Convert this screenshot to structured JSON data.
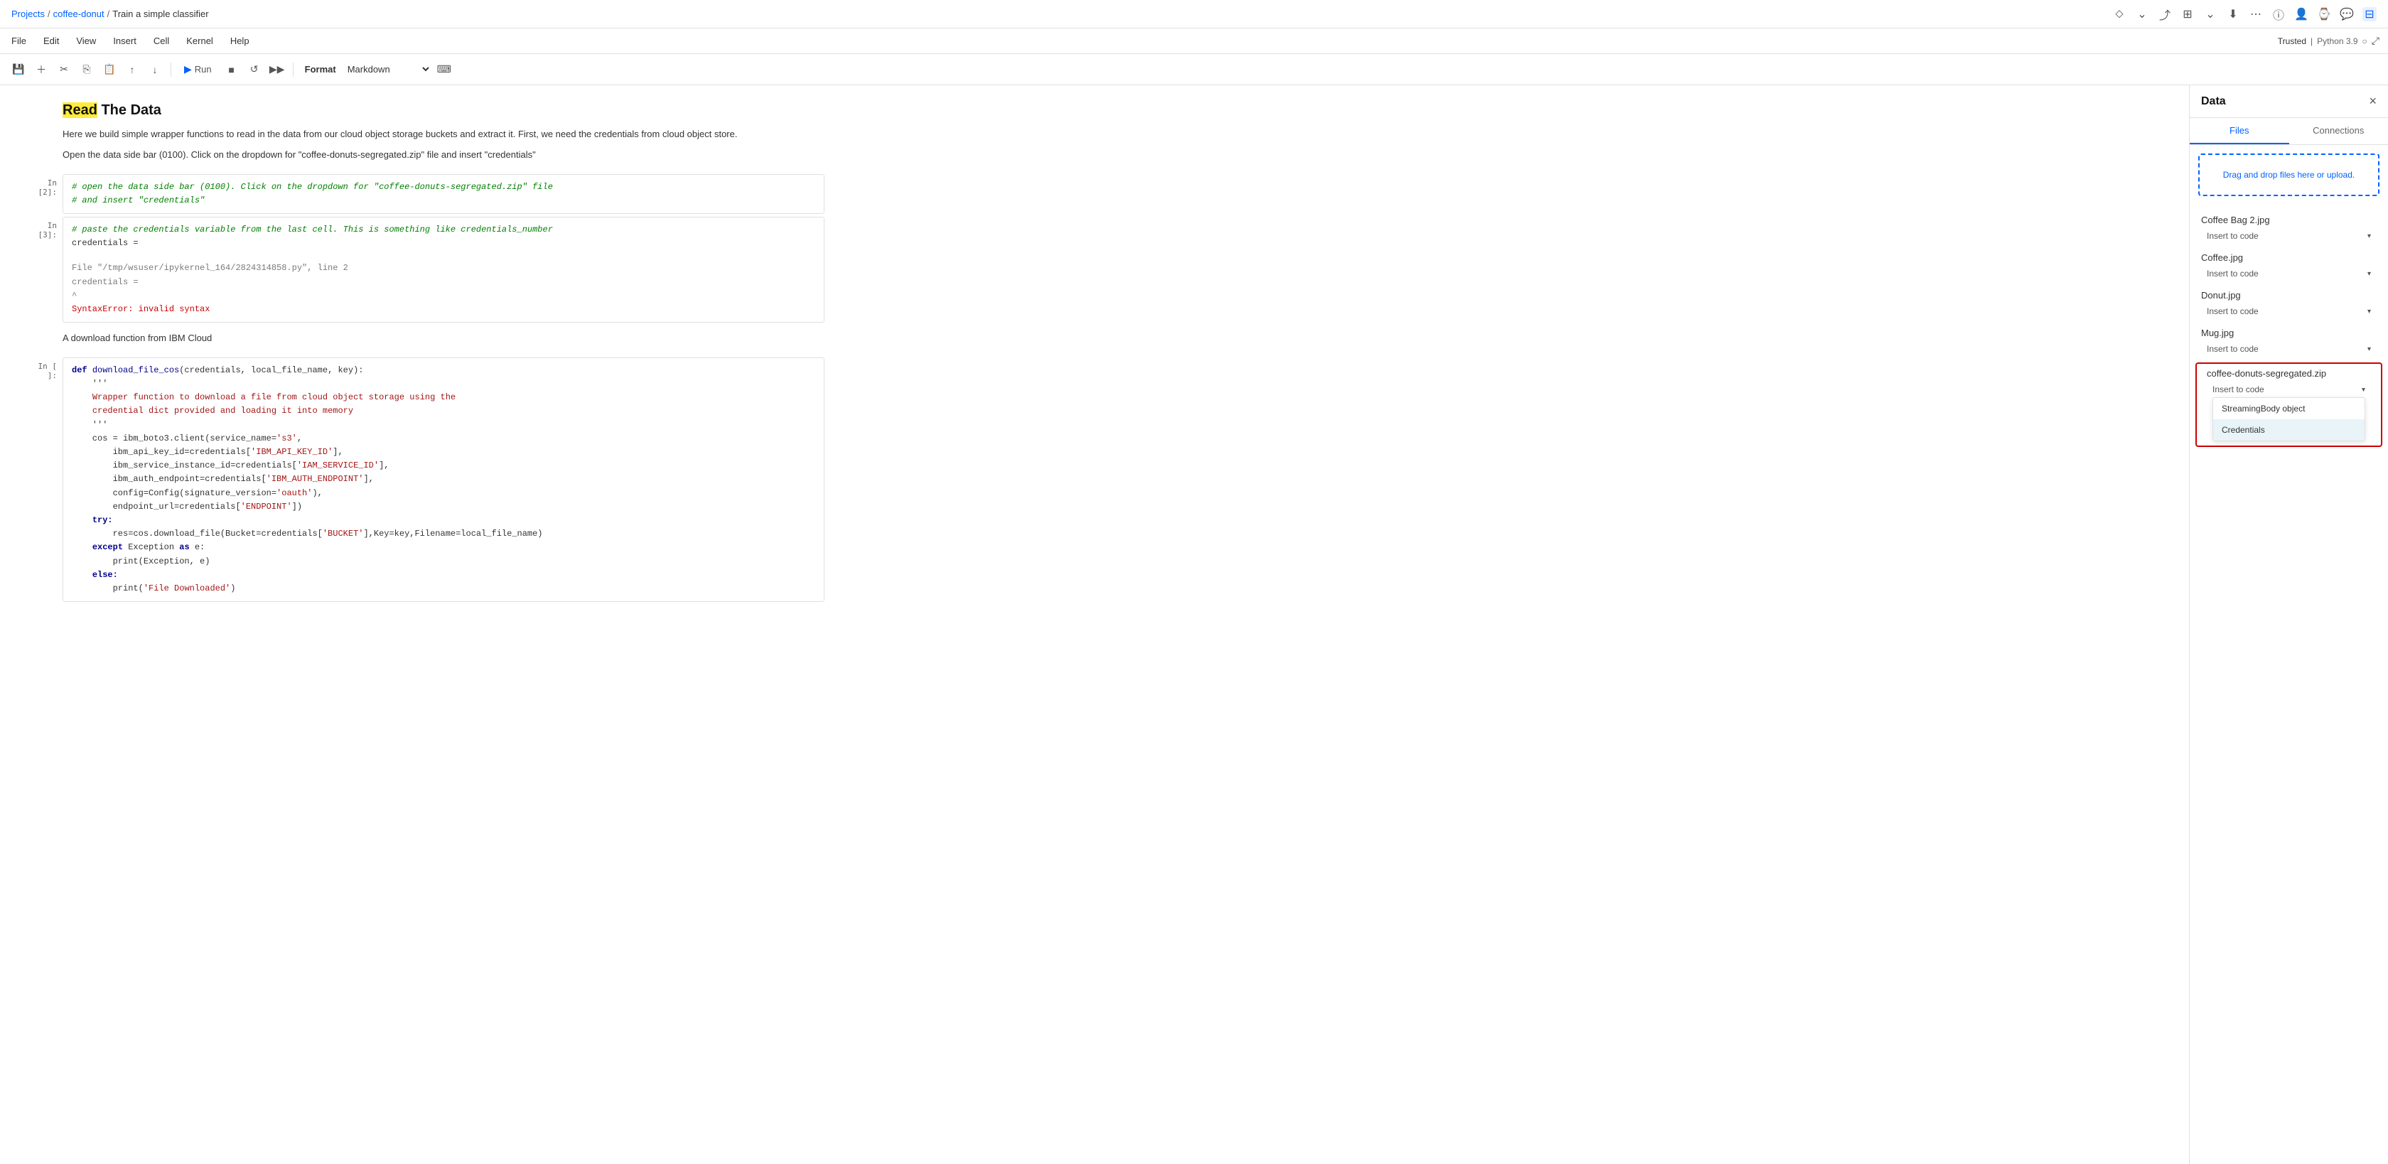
{
  "topnav": {
    "breadcrumb": [
      "Projects",
      "coffee-donut",
      "Train a simple classifier"
    ],
    "sep": "/"
  },
  "menubar": {
    "items": [
      "File",
      "Edit",
      "View",
      "Insert",
      "Cell",
      "Kernel",
      "Help"
    ],
    "trusted": "Trusted",
    "kernel": "Python 3.9"
  },
  "toolbar": {
    "format_label": "Format",
    "format_value": "Markdown",
    "run_label": "Run"
  },
  "notebook": {
    "title": "Read The Data",
    "title_highlight": "Read",
    "para1": "Here we build simple wrapper functions to read in the data from our cloud object storage buckets and extract it. First, we need the credentials from cloud object store.",
    "para2": "Open the data side bar (0100). Click on the dropdown for \"coffee-donuts-segregated.zip\" file and insert \"credentials\"",
    "cell2_label": "In [2]:",
    "cell2_code": "# open the data side bar (0100). Click on the dropdown for \"coffee-donuts-segregated.zip\" file\n# and insert \"credentials\"",
    "cell3_label": "In [3]:",
    "cell3_code": "# paste the credentials variable from the last cell. This is something like credentials_number\ncredentials =",
    "cell3_output_trace1": "File \"/tmp/wsuser/ipykernel_164/2824314858.py\", line 2",
    "cell3_output_trace2": "    credentials =",
    "cell3_output_trace3": "                 ^",
    "cell3_output_error": "SyntaxError: invalid syntax",
    "md_download": "A download function from IBM Cloud",
    "cell4_label": "In [ ]:",
    "cell4_code_lines": [
      "def download_file_cos(credentials, local_file_name, key):",
      "    '''",
      "    Wrapper function to download a file from cloud object storage using the",
      "    credential dict provided and loading it into memory",
      "    '''",
      "    cos = ibm_boto3.client(service_name='s3',",
      "        ibm_api_key_id=credentials['IBM_API_KEY_ID'],",
      "        ibm_service_instance_id=credentials['IAM_SERVICE_ID'],",
      "        ibm_auth_endpoint=credentials['IBM_AUTH_ENDPOINT'],",
      "        config=Config(signature_version='oauth'),",
      "        endpoint_url=credentials['ENDPOINT'])",
      "    try:",
      "        res=cos.download_file(Bucket=credentials['BUCKET'],Key=key,Filename=local_file_name)",
      "    except Exception as e:",
      "        print(Exception, e)",
      "    else:",
      "        print('File Downloaded')"
    ]
  },
  "panel": {
    "title": "Data",
    "tabs": [
      "Files",
      "Connections"
    ],
    "active_tab": "Files",
    "upload_text": "Drag and drop files here or upload.",
    "files": [
      {
        "name": "Coffee Bag 2.jpg",
        "insert_label": "Insert to code",
        "open": false
      },
      {
        "name": "Coffee.jpg",
        "insert_label": "Insert to code",
        "open": false
      },
      {
        "name": "Donut.jpg",
        "insert_label": "Insert to code",
        "open": false
      },
      {
        "name": "Mug.jpg",
        "insert_label": "Insert to code",
        "open": false
      },
      {
        "name": "coffee-donuts-segregated.zip",
        "insert_label": "Insert to code",
        "open": true,
        "highlighted": true
      }
    ],
    "dropdown_items": [
      "StreamingBody object",
      "Credentials"
    ],
    "selected_dropdown": "Credentials"
  }
}
